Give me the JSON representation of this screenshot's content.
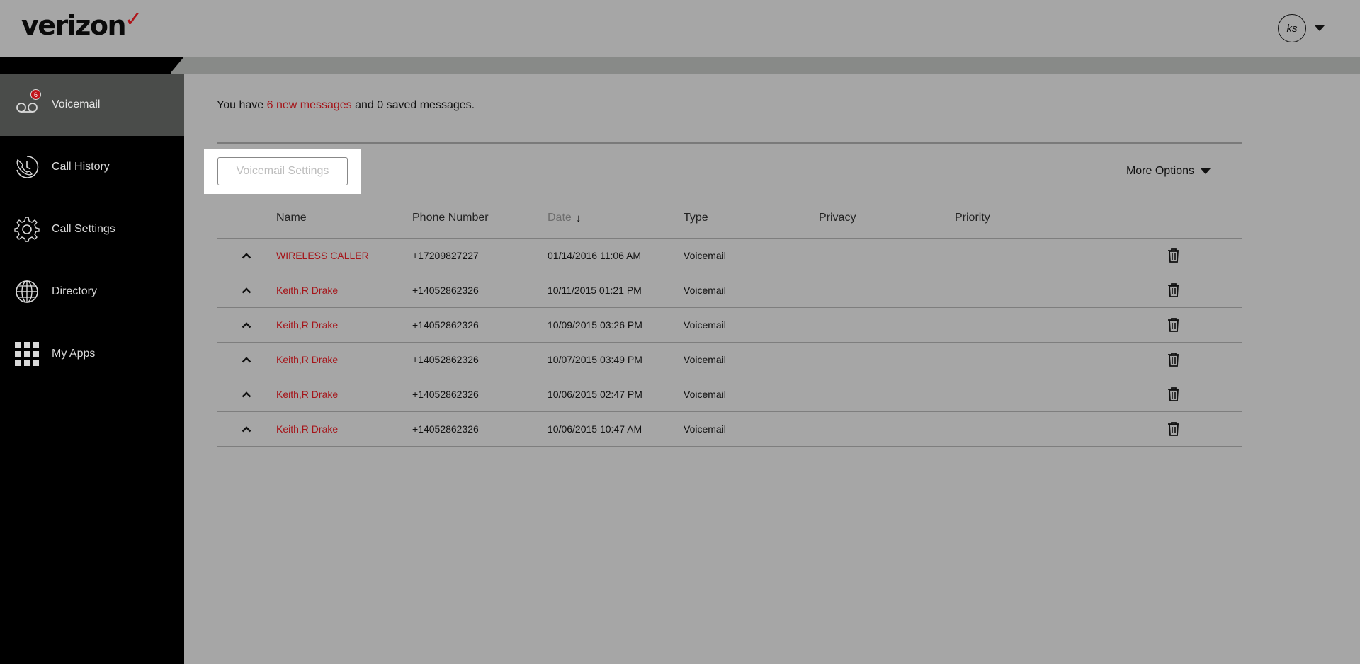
{
  "brand": {
    "name": "verizon",
    "check": "✓"
  },
  "user": {
    "initials": "ks"
  },
  "sidebar": {
    "items": [
      {
        "label": "Voicemail",
        "badge": "6"
      },
      {
        "label": "Call History"
      },
      {
        "label": "Call Settings"
      },
      {
        "label": "Directory"
      },
      {
        "label": "My Apps"
      }
    ]
  },
  "summary": {
    "prefix": "You have ",
    "new_link": "6 new messages",
    "suffix": " and 0 saved messages."
  },
  "toolbar": {
    "voicemail_settings": "Voicemail Settings",
    "more_options": "More Options"
  },
  "table": {
    "headers": {
      "name": "Name",
      "phone": "Phone Number",
      "date": "Date",
      "type": "Type",
      "privacy": "Privacy",
      "priority": "Priority"
    },
    "rows": [
      {
        "name": "WIRELESS CALLER",
        "phone": "+17209827227",
        "date": "01/14/2016 11:06 AM",
        "type": "Voicemail",
        "privacy": "",
        "priority": ""
      },
      {
        "name": "Keith,R Drake",
        "phone": "+14052862326",
        "date": "10/11/2015 01:21 PM",
        "type": "Voicemail",
        "privacy": "",
        "priority": ""
      },
      {
        "name": "Keith,R Drake",
        "phone": "+14052862326",
        "date": "10/09/2015 03:26 PM",
        "type": "Voicemail",
        "privacy": "",
        "priority": ""
      },
      {
        "name": "Keith,R Drake",
        "phone": "+14052862326",
        "date": "10/07/2015 03:49 PM",
        "type": "Voicemail",
        "privacy": "",
        "priority": ""
      },
      {
        "name": "Keith,R Drake",
        "phone": "+14052862326",
        "date": "10/06/2015 02:47 PM",
        "type": "Voicemail",
        "privacy": "",
        "priority": ""
      },
      {
        "name": "Keith,R Drake",
        "phone": "+14052862326",
        "date": "10/06/2015 10:47 AM",
        "type": "Voicemail",
        "privacy": "",
        "priority": ""
      }
    ]
  },
  "colors": {
    "accent_red": "#a5151a",
    "sidebar_bg": "#000000",
    "sidebar_active": "#4a4c4a",
    "page_bg": "#a6a6a6"
  }
}
